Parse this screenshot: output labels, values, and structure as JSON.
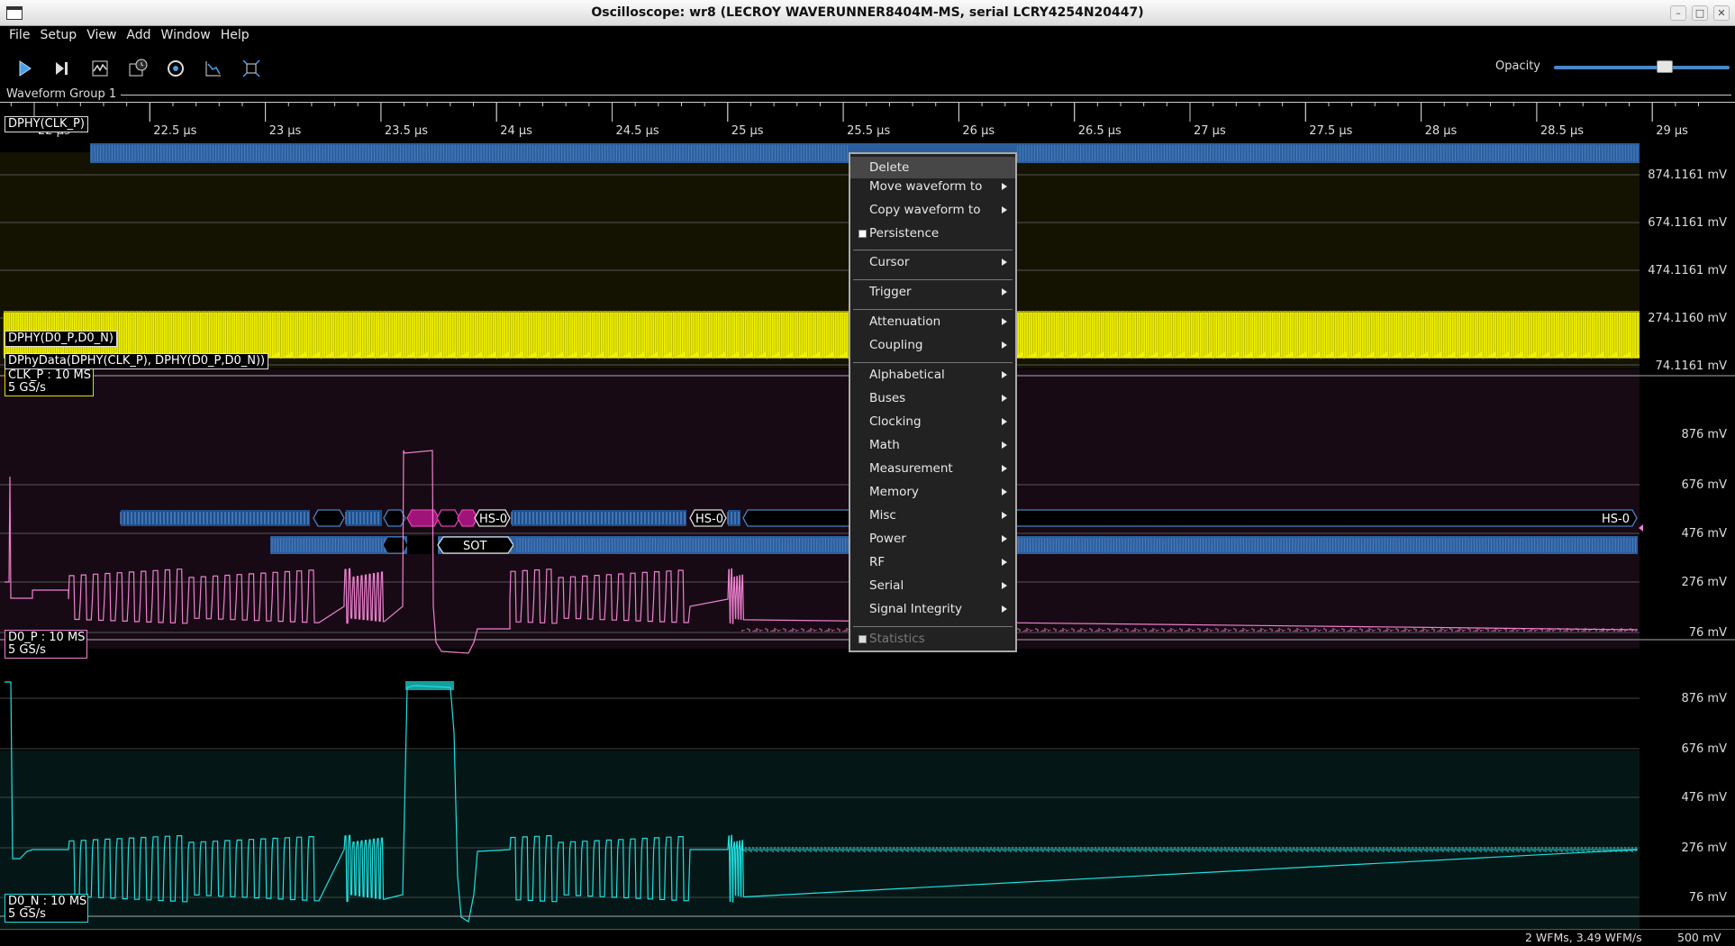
{
  "window": {
    "title": "Oscilloscope: wr8 (LECROY WAVERUNNER8404M-MS, serial LCRY4254N20447)",
    "controls": [
      "–",
      "□",
      "✕"
    ]
  },
  "menubar": [
    "File",
    "Setup",
    "View",
    "Add",
    "Window",
    "Help"
  ],
  "toolbar": {
    "icons": [
      "play-icon",
      "single-step-icon",
      "waveform-icon",
      "history-icon",
      "timebase-icon",
      "autoscale-icon",
      "fit-icon"
    ],
    "opacity_label": "Opacity",
    "opacity_value": 0.63
  },
  "group": {
    "title": "Waveform Group 1"
  },
  "time_axis": {
    "ticks": [
      "22 µs",
      "22.5 µs",
      "23 µs",
      "23.5 µs",
      "24 µs",
      "24.5 µs",
      "25 µs",
      "25.5 µs",
      "26 µs",
      "26.5 µs",
      "27 µs",
      "27.5 µs",
      "28 µs",
      "28.5 µs",
      "29 µs"
    ]
  },
  "channels": {
    "clk_decode": {
      "label": "DPHY(CLK_P)"
    },
    "clk_p": {
      "label_line1": "CLK_P : 10 MS",
      "label_line2": "5 GS/s",
      "color": "#f0f000",
      "y_ticks": [
        "874.1161 mV",
        "674.1161 mV",
        "474.1161 mV",
        "274.1160 mV",
        "74.1161 mV"
      ]
    },
    "d0_decode": {
      "label": "DPHY(D0_P,D0_N)",
      "packets": [
        "HS-0",
        "HS-0",
        "HS-0"
      ]
    },
    "dphy_data": {
      "label": "DPhyData(DPHY(CLK_P), DPHY(D0_P,D0_N))",
      "packet": "SOT"
    },
    "d0_p": {
      "label_line1": "D0_P : 10 MS",
      "label_line2": "5 GS/s",
      "color": "#f080d0",
      "y_ticks": [
        "876 mV",
        "676 mV",
        "476 mV",
        "276 mV",
        "76 mV"
      ]
    },
    "d0_n": {
      "label_line1": "D0_N : 10 MS",
      "label_line2": "5 GS/s",
      "color": "#20e0e0",
      "y_ticks": [
        "876 mV",
        "676 mV",
        "476 mV",
        "276 mV",
        "76 mV"
      ]
    }
  },
  "status": {
    "rate": "2 WFMs, 3.49 WFM/s",
    "scale": "500 mV"
  },
  "context_menu": {
    "delete": "Delete",
    "move": "Move waveform to",
    "copy": "Copy waveform to",
    "persistence": "Persistence",
    "cursor": "Cursor",
    "trigger": "Trigger",
    "attenuation": "Attenuation",
    "coupling": "Coupling",
    "alphabetical": "Alphabetical",
    "buses": "Buses",
    "clocking": "Clocking",
    "math": "Math",
    "measurement": "Measurement",
    "memory": "Memory",
    "misc": "Misc",
    "power": "Power",
    "rf": "RF",
    "serial": "Serial",
    "signal_integrity": "Signal Integrity",
    "statistics": "Statistics"
  }
}
